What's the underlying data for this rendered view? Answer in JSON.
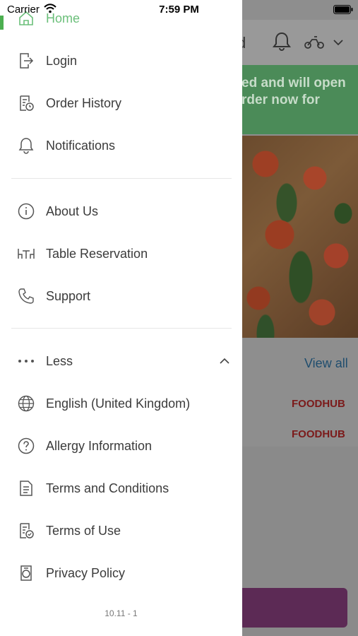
{
  "status_bar": {
    "carrier": "Carrier",
    "time": "7:59 PM"
  },
  "background": {
    "header_text": "d",
    "banner_text": "ed and will open\nrder now for",
    "view_all": "View all",
    "logos": [
      "FOODHUB",
      "FOODHUB"
    ]
  },
  "drawer": {
    "home": {
      "label": "Home",
      "icon": "home-icon"
    },
    "section1": [
      {
        "label": "Login",
        "icon": "login-icon"
      },
      {
        "label": "Order History",
        "icon": "order-history-icon"
      },
      {
        "label": "Notifications",
        "icon": "bell-icon"
      }
    ],
    "section2": [
      {
        "label": "About Us",
        "icon": "info-icon"
      },
      {
        "label": "Table Reservation",
        "icon": "table-icon"
      },
      {
        "label": "Support",
        "icon": "phone-icon"
      }
    ],
    "less": {
      "label": "Less",
      "icon": "more-dots-icon"
    },
    "section3": [
      {
        "label": "English (United Kingdom)",
        "icon": "globe-icon"
      },
      {
        "label": "Allergy Information",
        "icon": "question-icon"
      },
      {
        "label": "Terms and Conditions",
        "icon": "document-icon"
      },
      {
        "label": "Terms of Use",
        "icon": "document-check-icon"
      },
      {
        "label": "Privacy Policy",
        "icon": "privacy-icon"
      }
    ],
    "version": "10.11 - 1"
  },
  "colors": {
    "accent_green": "#4caf50",
    "home_text": "#6bbf7a",
    "banner_green": "#4b8b58",
    "button_purple": "#5c2a55"
  }
}
